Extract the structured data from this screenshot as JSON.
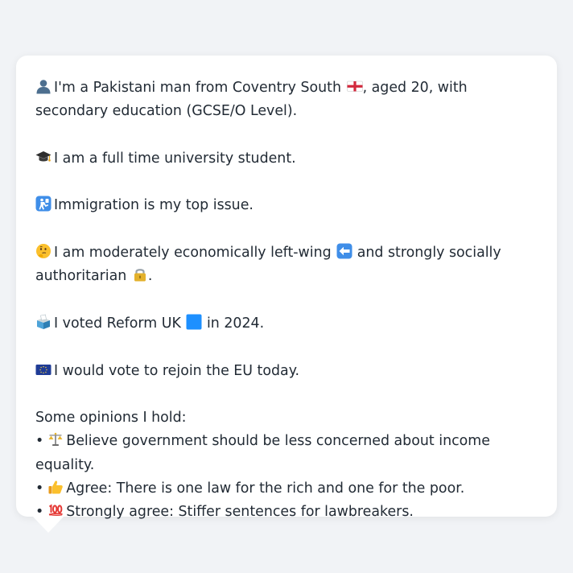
{
  "profile": {
    "intro": {
      "text_a": "I'm a Pakistani man from Coventry South",
      "text_b": ", aged 20, with secondary education (GCSE/O Level).",
      "icon": "bust-in-silhouette-icon"
    },
    "flag_icon": "england-flag-icon",
    "occupation": {
      "text": "I am a full time university student.",
      "icon": "graduation-cap-icon"
    },
    "top_issue": {
      "text": "Immigration is my top issue.",
      "icon": "passport-control-icon"
    },
    "ideology": {
      "text_a": "I am moderately economically left-wing",
      "text_b": "and strongly socially authoritarian",
      "text_c": ".",
      "icon": "thinking-face-icon",
      "left_icon": "left-arrow-icon",
      "lock_icon": "padlock-icon"
    },
    "vote_2024": {
      "text_a": "I voted Reform UK",
      "text_b": "in 2024.",
      "icon": "ballot-box-icon",
      "party_icon": "blue-square-icon",
      "party_color": "#1e90ff"
    },
    "eu": {
      "text": "I would vote to rejoin the EU today.",
      "icon": "eu-flag-icon"
    },
    "opinions_heading": "Some opinions I hold:",
    "bullet": "•",
    "opinions": [
      {
        "text": "Believe government should be less concerned about income equality.",
        "icon": "scales-icon"
      },
      {
        "text": "Agree: There is one law for the rich and one for the poor.",
        "icon": "thumbs-up-icon"
      },
      {
        "text": "Strongly agree: Stiffer sentences for lawbreakers.",
        "icon": "hundred-points-icon"
      }
    ]
  },
  "colors": {
    "background": "#f1f3f6",
    "card": "#ffffff",
    "text": "#222b35"
  }
}
